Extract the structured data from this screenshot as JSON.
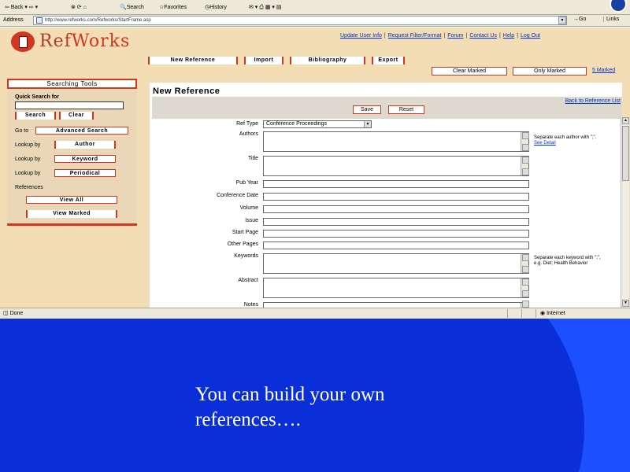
{
  "browser": {
    "toolbar": {
      "back": "Back",
      "search": "Search",
      "favorites": "Favorites",
      "history": "History"
    },
    "address_label": "Address",
    "url": "http://www.refworks.com/Refworks/StartFrame.asp",
    "go": "Go",
    "links": "Links"
  },
  "app": {
    "logo_ref": "Ref",
    "logo_works": "Works",
    "top_links": [
      "Update User Info",
      "Request Filter/Format",
      "Forum",
      "Contact Us",
      "Help",
      "Log Out"
    ],
    "nav_tabs": [
      "New Reference",
      "Import",
      "Bibliography",
      "Export"
    ],
    "clear_marked": "Clear Marked",
    "only_marked": "Only Marked",
    "marked_count": "5 Marked"
  },
  "sidebar": {
    "title": "Searching Tools",
    "quick_search_label": "Quick Search for",
    "search_btn": "Search",
    "clear_btn": "Clear",
    "go_to_label": "Go to",
    "advanced_search": "Advanced Search",
    "lookup_label": "Lookup by",
    "author": "Author",
    "keyword": "Keyword",
    "periodical": "Periodical",
    "references_label": "References",
    "view_all": "View All",
    "view_marked": "View Marked"
  },
  "form": {
    "title": "New Reference",
    "back_link": "Back to Reference List",
    "save": "Save",
    "reset": "Reset",
    "ref_type_label": "Ref Type",
    "ref_type_value": "Conference Proceedings",
    "labels": {
      "authors": "Authors",
      "title": "Title",
      "pub_year": "Pub Year",
      "conference_date": "Conference Date",
      "volume": "Volume",
      "issue": "Issue",
      "start_page": "Start Page",
      "other_pages": "Other Pages",
      "keywords": "Keywords",
      "abstract": "Abstract",
      "notes": "Notes"
    },
    "authors_hint": "Separate each author with \";\".",
    "authors_hint_link": "See Detail",
    "keywords_hint": "Separate each keyword with \";\", e.g. Diet; Health Behavior"
  },
  "status": {
    "left": "Done",
    "zone": "Internet"
  },
  "slide": {
    "caption": "You can build your own references…."
  }
}
